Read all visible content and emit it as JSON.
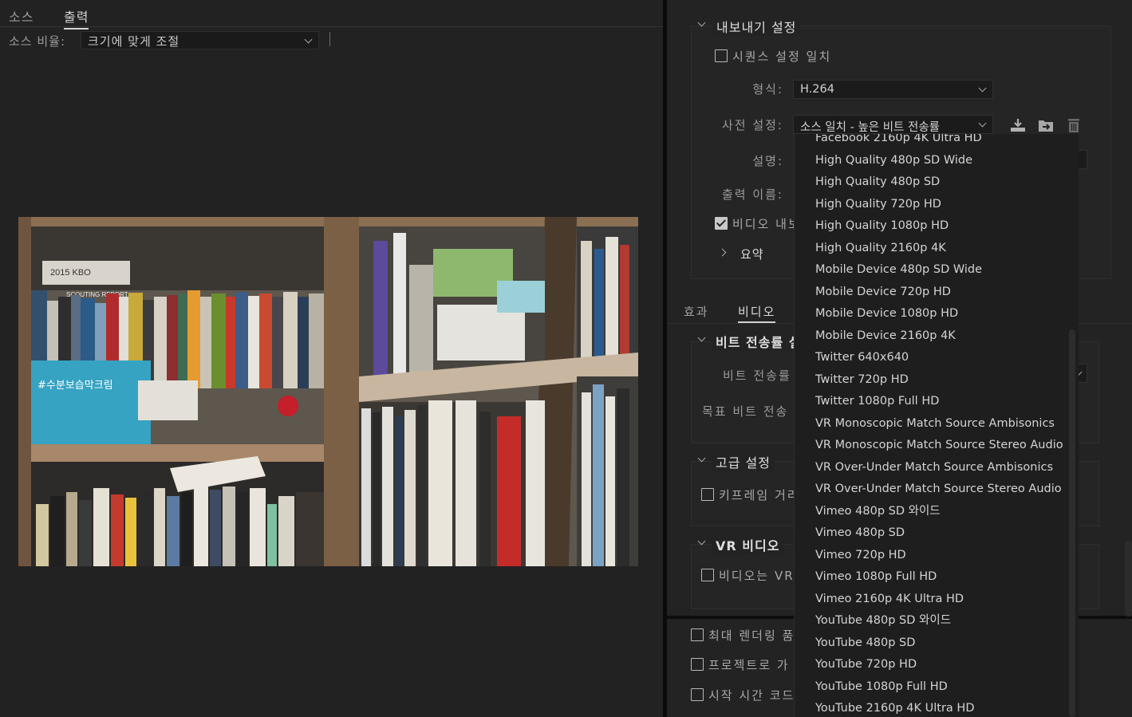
{
  "left_tabs": {
    "source": "소스",
    "output": "출력"
  },
  "source_scale": {
    "label": "소스 비율:",
    "value": "크기에 맞게 조절"
  },
  "export_settings": {
    "title": "내보내기 설정",
    "match_sequence_label": "시퀀스 설정 일치",
    "format_label": "형식:",
    "format_value": "H.264",
    "preset_label": "사전 설정:",
    "preset_value": "소스 일치 - 높은 비트 전송률",
    "description_label": "설명:",
    "output_name_label": "출력 이름:",
    "export_video_label": "비디오 내보",
    "summary_label": "요약"
  },
  "sub_tabs": {
    "effects": "효과",
    "video": "비디오"
  },
  "bitrate_section": {
    "title": "비트 전송률 설",
    "bitrate_label": "비트 전송률",
    "target_label": "목표 비트 전송"
  },
  "advanced_section": {
    "title": "고급 설정",
    "keyframe_label": "키프레임 거리"
  },
  "vr_section": {
    "title": "VR 비디오",
    "vr_label": "비디오는 VR"
  },
  "bottom_options": {
    "max_render": "최대 렌더링 품",
    "use_previews": "프로젝트로 가",
    "start_timecode": "시작 시간 코드"
  },
  "preset_list": [
    "Facebook 2160p 4K Ultra HD",
    "High Quality 480p SD Wide",
    "High Quality 480p SD",
    "High Quality 720p HD",
    "High Quality 1080p HD",
    "High Quality 2160p 4K",
    "Mobile Device 480p SD Wide",
    "Mobile Device 720p HD",
    "Mobile Device 1080p HD",
    "Mobile Device 2160p 4K",
    "Twitter 640x640",
    "Twitter 720p HD",
    "Twitter 1080p Full HD",
    "VR Monoscopic Match Source Ambisonics",
    "VR Monoscopic Match Source Stereo Audio",
    "VR Over-Under Match Source Ambisonics",
    "VR Over-Under Match Source Stereo Audio",
    "Vimeo 480p SD 와이드",
    "Vimeo 480p SD",
    "Vimeo 720p HD",
    "Vimeo 1080p Full HD",
    "Vimeo 2160p 4K Ultra HD",
    "YouTube 480p SD 와이드",
    "YouTube 480p SD",
    "YouTube 720p HD",
    "YouTube 1080p Full HD",
    "YouTube 2160p 4K Ultra HD"
  ],
  "preview_text": {
    "sign1": "2015 KBO",
    "sign2": "SCOUTING REPORT",
    "sign3": "#수분보습막크림"
  },
  "icons": {
    "save_preset": "download-icon",
    "import_preset": "folder-import-icon",
    "delete_preset": "trash-icon"
  }
}
